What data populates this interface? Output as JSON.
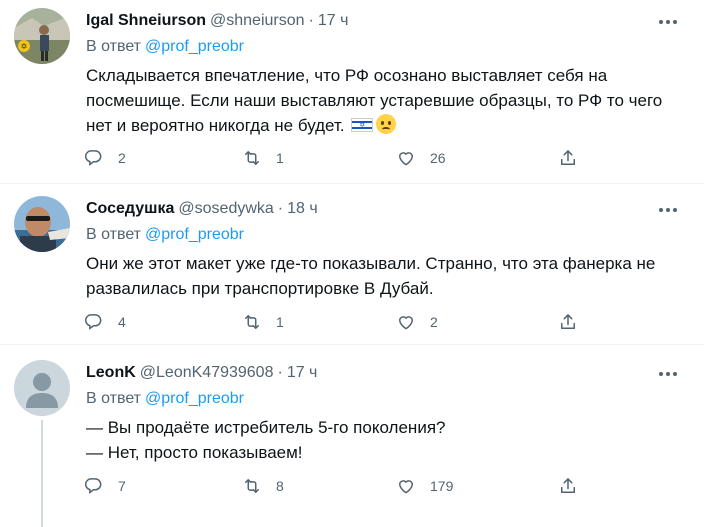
{
  "reply_prefix": "В ответ",
  "tweets": [
    {
      "name": "Igal Shneiurson",
      "handle": "@shneiurson",
      "time": "17 ч",
      "reply_to": "@prof_preobr",
      "lines": [
        "Складывается впечатление, что РФ осознано выставляет себя на",
        "посмешище. Если наши выставляют устаревшие образцы, то РФ то чего",
        "нет и вероятно никогда не будет."
      ],
      "emojis": [
        "flag-israel-icon",
        "woozy-face-icon"
      ],
      "replies": "2",
      "retweets": "1",
      "likes": "26"
    },
    {
      "name": "Соседушка",
      "handle": "@sosedywka",
      "time": "18 ч",
      "reply_to": "@prof_preobr",
      "lines": [
        "Они же этот макет уже где-то показывали. Странно, что эта фанерка не",
        "развалилась при транспортировке В Дубай."
      ],
      "replies": "4",
      "retweets": "1",
      "likes": "2"
    },
    {
      "name": "LeonK",
      "handle": "@LeonK47939608",
      "time": "17 ч",
      "reply_to": "@prof_preobr",
      "lines": [
        "— Вы продаёте истребитель 5-го поколения?",
        "— Нет, просто показываем!"
      ],
      "replies": "7",
      "retweets": "8",
      "likes": "179"
    }
  ],
  "colors": {
    "text": "#0f1419",
    "muted": "#536471",
    "link": "#1d9bf0",
    "divider": "#eff3f4"
  }
}
